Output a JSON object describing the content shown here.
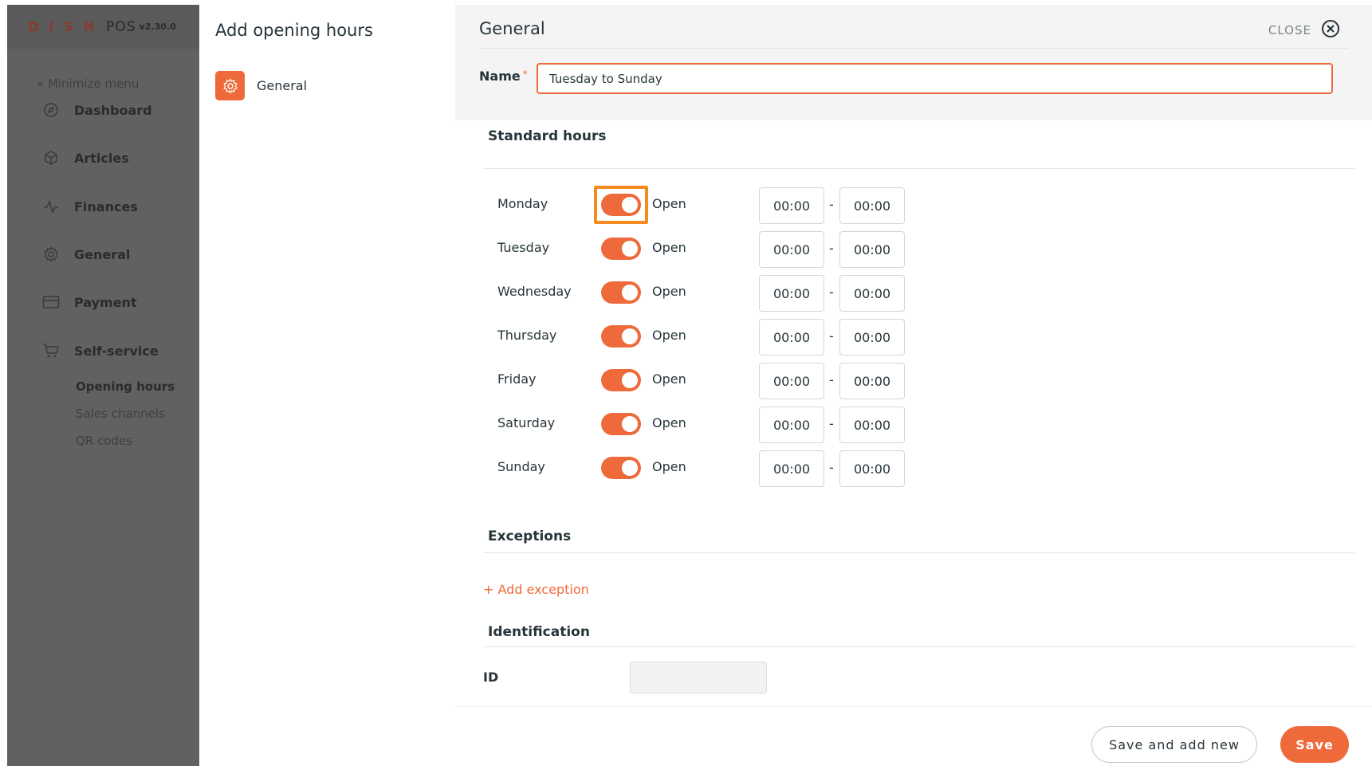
{
  "sidebar": {
    "logo_letters": "DISH",
    "logo_pos": "POS",
    "version": "v2.30.0",
    "minimize_label": "« Minimize menu",
    "items": [
      {
        "label": "Dashboard",
        "icon": "compass-icon"
      },
      {
        "label": "Articles",
        "icon": "box-icon"
      },
      {
        "label": "Finances",
        "icon": "pulse-icon"
      },
      {
        "label": "General",
        "icon": "gear-icon"
      },
      {
        "label": "Payment",
        "icon": "card-icon"
      },
      {
        "label": "Self-service",
        "icon": "cart-icon"
      }
    ],
    "sub_items": [
      {
        "label": "Opening hours",
        "active": true
      },
      {
        "label": "Sales channels",
        "active": false
      },
      {
        "label": "QR codes",
        "active": false
      }
    ]
  },
  "middle": {
    "title": "Add opening hours",
    "item_label": "General"
  },
  "panel": {
    "title": "General",
    "close_label": "CLOSE",
    "name_label": "Name",
    "name_required": "*",
    "name_value": "Tuesday to Sunday",
    "standard_hours_title": "Standard hours",
    "exceptions_title": "Exceptions",
    "add_exception_label": "+ Add exception",
    "identification_title": "Identification",
    "id_label": "ID",
    "id_value": "",
    "days": [
      {
        "name": "Monday",
        "status": "Open",
        "start": "00:00",
        "end": "00:00"
      },
      {
        "name": "Tuesday",
        "status": "Open",
        "start": "00:00",
        "end": "00:00"
      },
      {
        "name": "Wednesday",
        "status": "Open",
        "start": "00:00",
        "end": "00:00"
      },
      {
        "name": "Thursday",
        "status": "Open",
        "start": "00:00",
        "end": "00:00"
      },
      {
        "name": "Friday",
        "status": "Open",
        "start": "00:00",
        "end": "00:00"
      },
      {
        "name": "Saturday",
        "status": "Open",
        "start": "00:00",
        "end": "00:00"
      },
      {
        "name": "Sunday",
        "status": "Open",
        "start": "00:00",
        "end": "00:00"
      }
    ],
    "separator": "-"
  },
  "footer": {
    "save_and_add_new_label": "Save and add new",
    "save_label": "Save"
  },
  "colors": {
    "accent": "#ef6a3a",
    "highlight": "#f58a1f",
    "sidebar_overlay": "#616161"
  }
}
